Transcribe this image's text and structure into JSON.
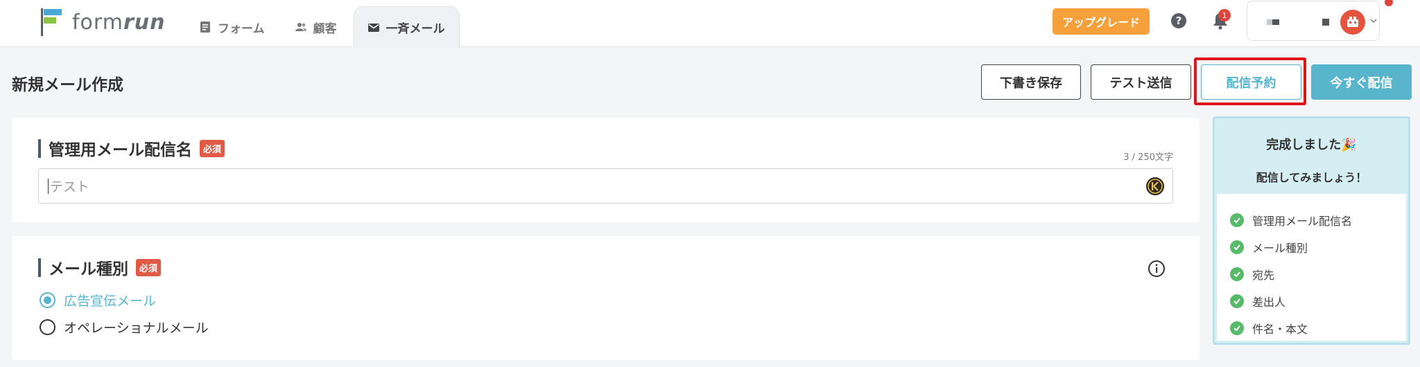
{
  "app": {
    "logo_text_light": "form",
    "logo_text_bold": "run"
  },
  "nav": {
    "tabs": [
      {
        "label": "フォーム",
        "icon": "form-icon",
        "active": false
      },
      {
        "label": "顧客",
        "icon": "users-icon",
        "active": false
      },
      {
        "label": "一斉メール",
        "icon": "mail-icon",
        "active": true
      }
    ]
  },
  "header": {
    "upgrade_label": "アップグレード",
    "help_label": "?",
    "notification_count": "1"
  },
  "page": {
    "title": "新規メール作成",
    "buttons": {
      "draft": "下書き保存",
      "test": "テスト送信",
      "schedule": "配信予約",
      "send_now": "今すぐ配信"
    }
  },
  "name_section": {
    "title": "管理用メール配信名",
    "required": "必須",
    "counter": "3 / 250文字",
    "value": "テスト"
  },
  "type_section": {
    "title": "メール種別",
    "required": "必須",
    "options": [
      {
        "label": "広告宣伝メール",
        "selected": true
      },
      {
        "label": "オペレーショナルメール",
        "selected": false
      }
    ]
  },
  "side_panel": {
    "line1": "完成しました🎉",
    "line2": "配信してみましょう！",
    "items": [
      "管理用メール配信名",
      "メール種別",
      "宛先",
      "差出人",
      "件名・本文"
    ]
  },
  "colors": {
    "accent": "#58b5cc",
    "upgrade": "#f5a03a",
    "required": "#e05a46",
    "check": "#57b96a",
    "highlight": "#e0141d"
  }
}
